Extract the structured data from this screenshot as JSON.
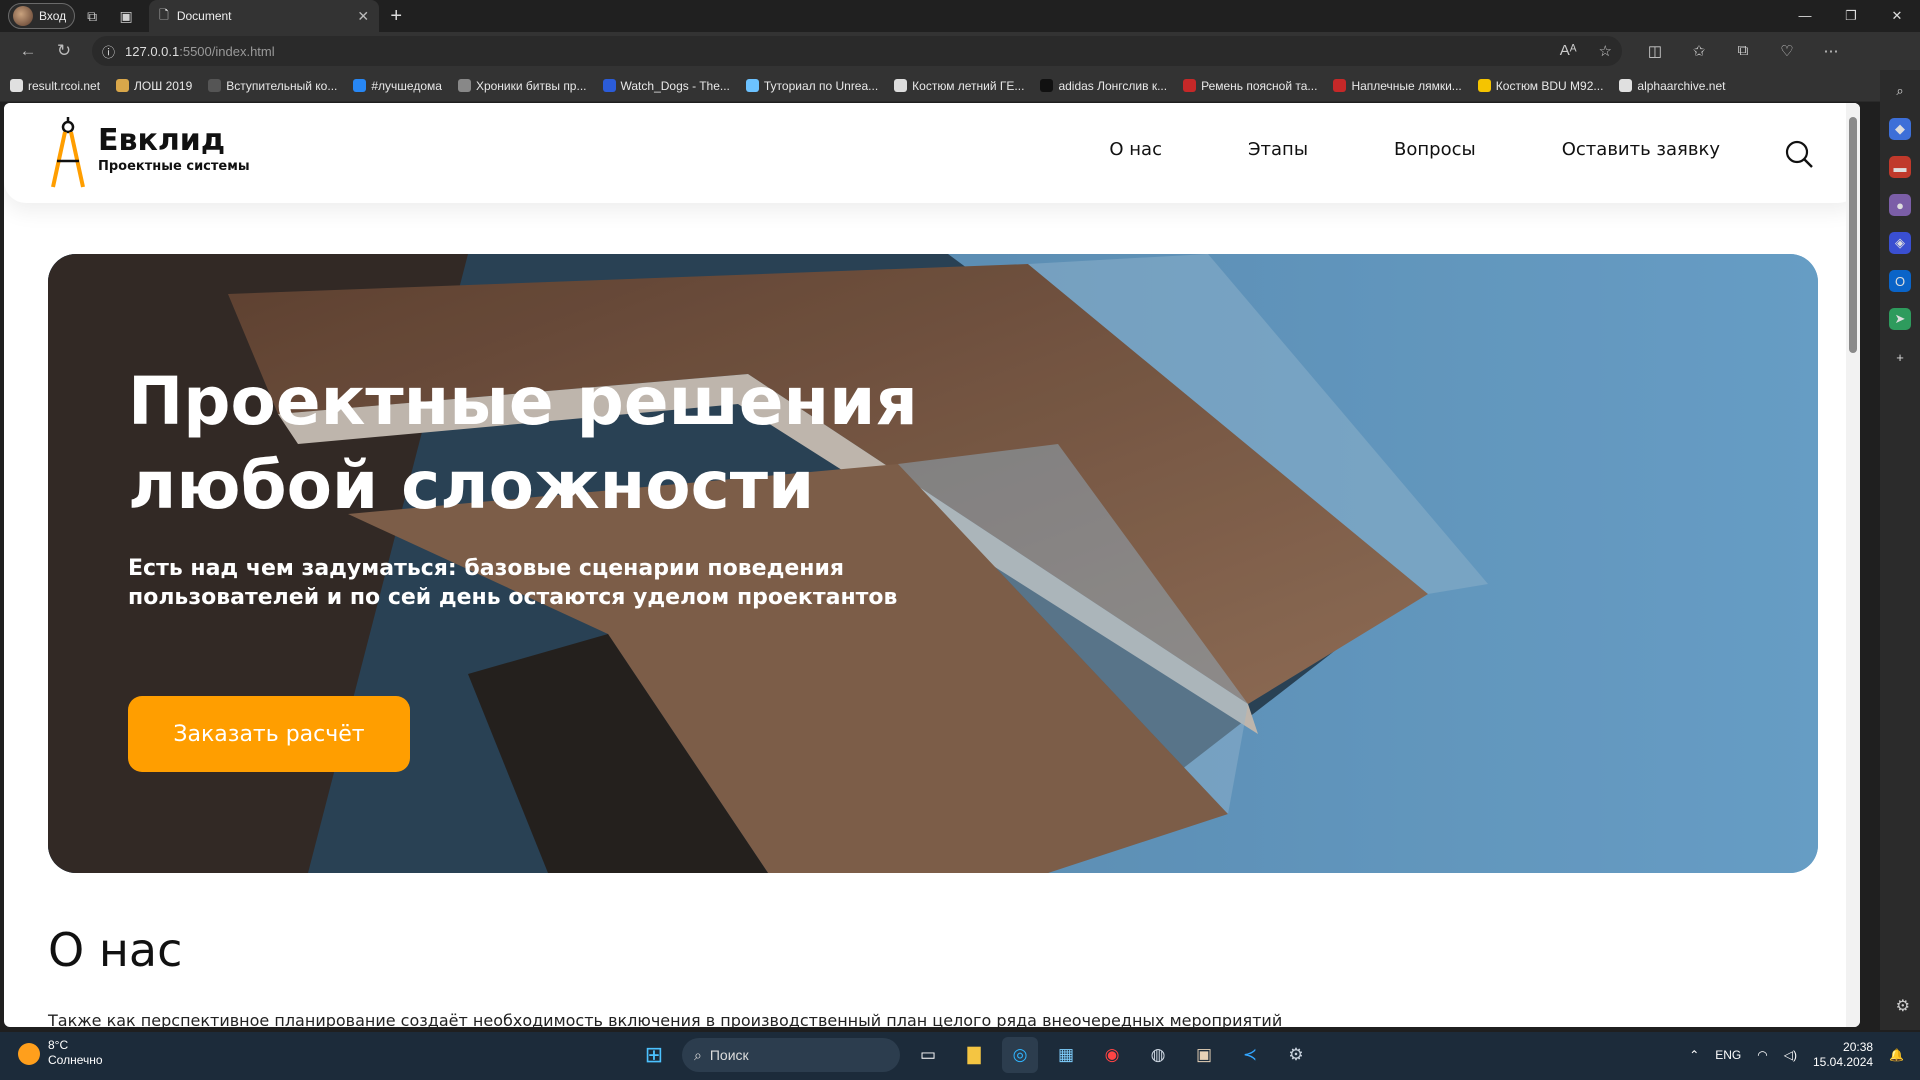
{
  "browser": {
    "profile_label": "Вход",
    "tab_title": "Document",
    "url_host": "127.0.0.1",
    "url_rest": ":5500/index.html",
    "bookmarks": [
      {
        "label": "result.rcoi.net",
        "color": "#e0e0e0"
      },
      {
        "label": "ЛОШ 2019",
        "color": "#d9a74a"
      },
      {
        "label": "Вступительный ко...",
        "color": "#555"
      },
      {
        "label": "#лучшедома",
        "color": "#2787f5"
      },
      {
        "label": "Хроники битвы пр...",
        "color": "#888"
      },
      {
        "label": "Watch_Dogs - The...",
        "color": "#2b5cd9"
      },
      {
        "label": "Туториал по Unrea...",
        "color": "#6cc2ff"
      },
      {
        "label": "Костюм летний ГЕ...",
        "color": "#ddd"
      },
      {
        "label": "adidas Лонгслив к...",
        "color": "#111"
      },
      {
        "label": "Ремень поясной та...",
        "color": "#c62828"
      },
      {
        "label": "Наплечные лямки...",
        "color": "#c62828"
      },
      {
        "label": "Костюм BDU M92...",
        "color": "#f5c400"
      },
      {
        "label": "alphaarchive.net",
        "color": "#e0e0e0"
      }
    ]
  },
  "site": {
    "logo_name": "Евклид",
    "logo_sub": "Проектные системы",
    "nav": [
      "О нас",
      "Этапы",
      "Вопросы",
      "Оставить заявку"
    ],
    "hero_title": "Проектные решения любой сложности",
    "hero_lead": "Есть над чем задуматься: базовые сценарии поведения пользователей и по сей день остаются уделом проектантов",
    "cta": "Заказать расчёт",
    "about_title": "О нас",
    "about_text": "Также как перспективное планирование создаёт необходимость включения в производственный план целого ряда внеочередных мероприятий",
    "accent_color": "#ff9e00"
  },
  "taskbar": {
    "temp": "8°C",
    "weather": "Солнечно",
    "search_placeholder": "Поиск",
    "lang": "ENG",
    "time": "20:38",
    "date": "15.04.2024"
  }
}
